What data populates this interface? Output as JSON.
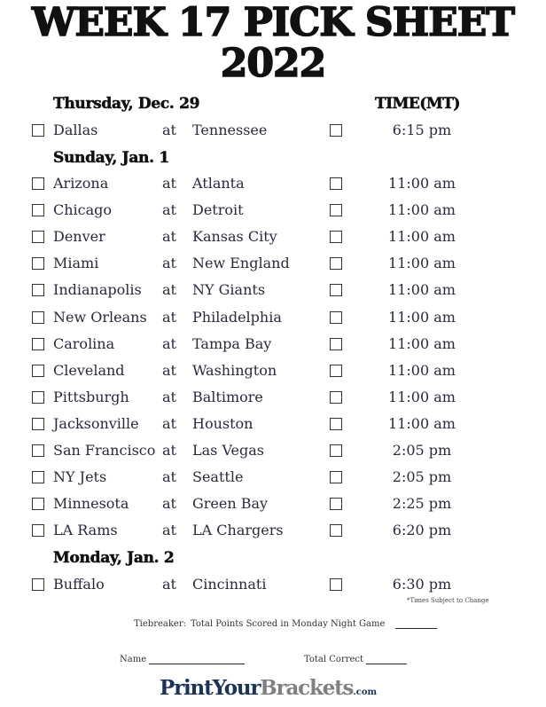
{
  "title": {
    "line1": "WEEK 17 PICK SHEET",
    "line2": "2022"
  },
  "time_header": "TIME(MT)",
  "days": [
    {
      "label": "Thursday, Dec. 29",
      "games": [
        {
          "away": "Dallas",
          "at": "at",
          "home": "Tennessee",
          "time": "6:15 pm"
        }
      ]
    },
    {
      "label": "Sunday, Jan. 1",
      "games": [
        {
          "away": "Arizona",
          "at": "at",
          "home": "Atlanta",
          "time": "11:00 am"
        },
        {
          "away": "Chicago",
          "at": "at",
          "home": "Detroit",
          "time": "11:00 am"
        },
        {
          "away": "Denver",
          "at": "at",
          "home": "Kansas City",
          "time": "11:00 am"
        },
        {
          "away": "Miami",
          "at": "at",
          "home": "New England",
          "time": "11:00 am"
        },
        {
          "away": "Indianapolis",
          "at": "at",
          "home": "NY Giants",
          "time": "11:00 am"
        },
        {
          "away": "New Orleans",
          "at": "at",
          "home": "Philadelphia",
          "time": "11:00 am"
        },
        {
          "away": "Carolina",
          "at": "at",
          "home": "Tampa Bay",
          "time": "11:00 am"
        },
        {
          "away": "Cleveland",
          "at": "at",
          "home": "Washington",
          "time": "11:00 am"
        },
        {
          "away": "Pittsburgh",
          "at": "at",
          "home": "Baltimore",
          "time": "11:00 am"
        },
        {
          "away": "Jacksonville",
          "at": "at",
          "home": "Houston",
          "time": "11:00 am"
        },
        {
          "away": "San Francisco",
          "at": "at",
          "home": "Las Vegas",
          "time": "2:05 pm"
        },
        {
          "away": "NY Jets",
          "at": "at",
          "home": "Seattle",
          "time": "2:05 pm"
        },
        {
          "away": "Minnesota",
          "at": "at",
          "home": "Green Bay",
          "time": "2:25 pm"
        },
        {
          "away": "LA Rams",
          "at": "at",
          "home": "LA Chargers",
          "time": "6:20 pm"
        }
      ]
    },
    {
      "label": "Monday, Jan. 2",
      "games": [
        {
          "away": "Buffalo",
          "at": "at",
          "home": "Cincinnati",
          "time": "6:30 pm"
        }
      ]
    }
  ],
  "note": "*Times Subject to Change",
  "tiebreaker": {
    "label": "Tiebreaker:",
    "text": "Total Points Scored in Monday Night Game"
  },
  "name_label": "Name",
  "total_correct_label": "Total Correct",
  "logo": {
    "part1": "PrintYour",
    "part2": "Brackets",
    "part3": ".com"
  }
}
